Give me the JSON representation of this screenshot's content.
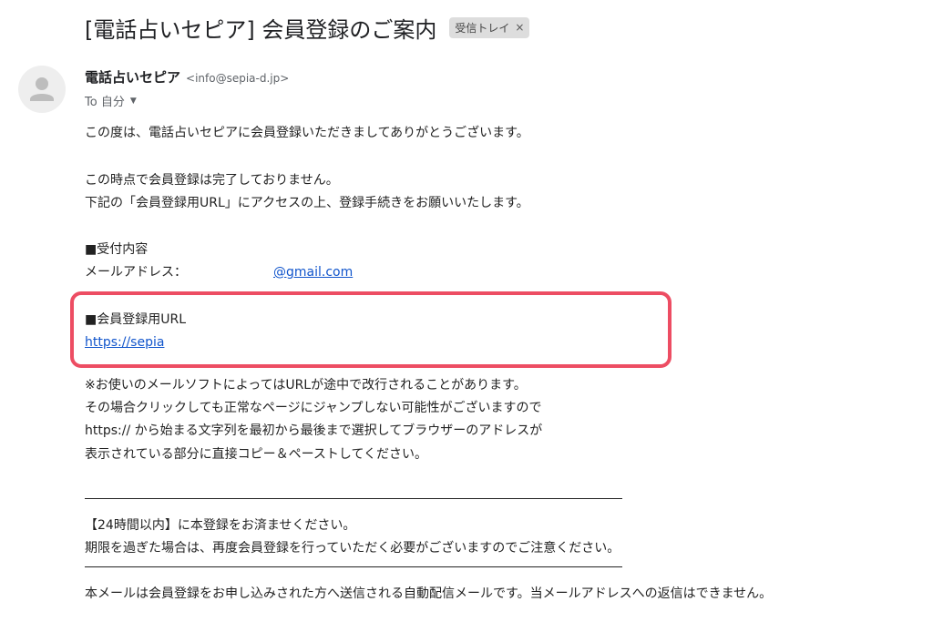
{
  "subject": {
    "title": "[電話占いセピア] 会員登録のご案内",
    "label": "受信トレイ",
    "label_remove": "×"
  },
  "sender": {
    "name": "電話占いセピア",
    "email": "<info@sepia-d.jp>",
    "avatar_icon": "person-icon"
  },
  "recipient": {
    "text": "To 自分",
    "caret": "▼"
  },
  "body": {
    "greeting": "この度は、電話占いセピアに会員登録いただきましてありがとうございます。",
    "notice_1": "この時点で会員登録は完了しておりません。",
    "notice_2": "下記の「会員登録用URL」にアクセスの上、登録手続きをお願いいたします。",
    "reception_heading": "■受付内容",
    "email_label": "メールアドレス：",
    "email_value": "@gmail.com",
    "url_heading": "■会員登録用URL",
    "url_link": "https://sepia",
    "note_1": "※お使いのメールソフトによってはURLが途中で改行されることがあります。",
    "note_2": "その場合クリックしても正常なページにジャンプしない可能性がございますので",
    "note_3": "https:// から始まる文字列を最初から最後まで選択してブラウザーのアドレスが",
    "note_4": "表示されている部分に直接コピー＆ペーストしてください。",
    "deadline_1": "【24時間以内】に本登録をお済ませください。",
    "deadline_2": "期限を過ぎた場合は、再度会員登録を行っていただく必要がございますのでご注意ください。",
    "footer": "本メールは会員登録をお申し込みされた方へ送信される自動配信メールです。当メールアドレスへの返信はできません。"
  },
  "colors": {
    "highlight_border": "#ed4d63",
    "link": "#1155cc"
  }
}
